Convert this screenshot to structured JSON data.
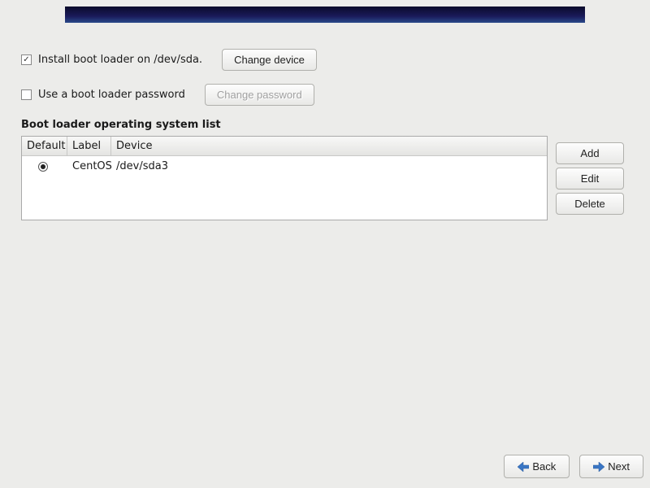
{
  "install_bootloader": {
    "checked": true,
    "label": "Install boot loader on /dev/sda.",
    "change_button": "Change device"
  },
  "use_password": {
    "checked": false,
    "label": "Use a boot loader password",
    "change_button": "Change password"
  },
  "os_list": {
    "title": "Boot loader operating system list",
    "headers": {
      "default": "Default",
      "label": "Label",
      "device": "Device"
    },
    "rows": [
      {
        "default": true,
        "label": "CentOS",
        "device": "/dev/sda3"
      }
    ]
  },
  "buttons": {
    "add": "Add",
    "edit": "Edit",
    "delete": "Delete",
    "back": "Back",
    "next": "Next"
  }
}
